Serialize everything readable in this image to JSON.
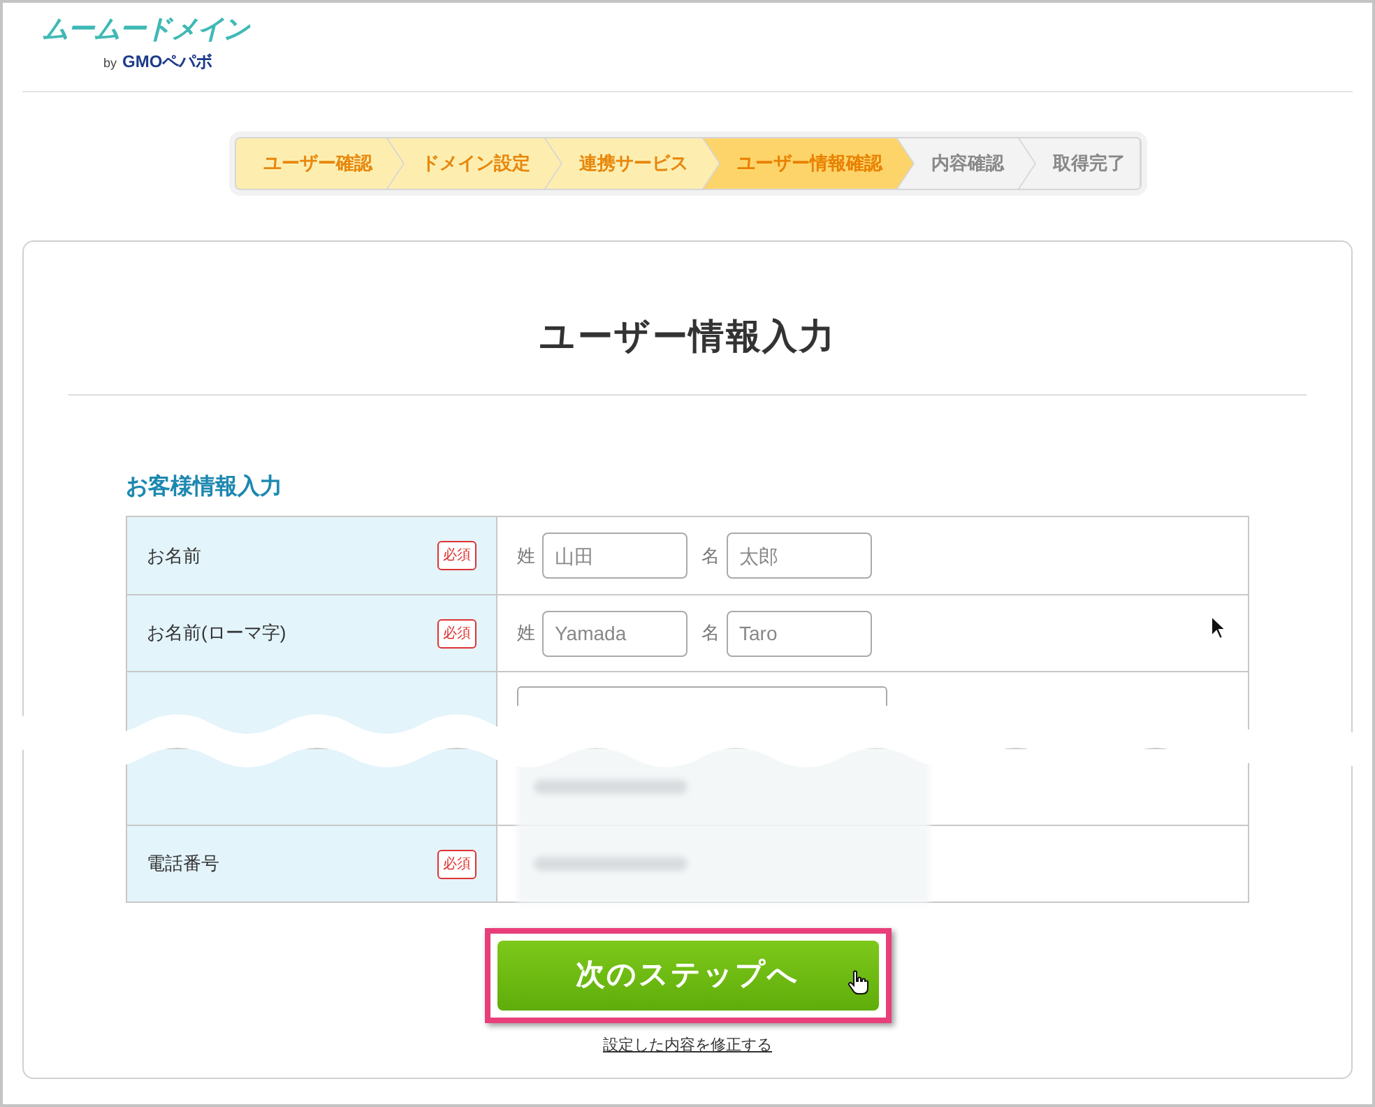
{
  "logo": {
    "name": "ムームードメイン",
    "by": "by",
    "company": "GMOペパボ"
  },
  "steps": [
    {
      "label": "ユーザー確認",
      "completed": true,
      "selected": false
    },
    {
      "label": "ドメイン設定",
      "completed": true,
      "selected": false
    },
    {
      "label": "連携サービス",
      "completed": true,
      "selected": false
    },
    {
      "label": "ユーザー情報確認",
      "completed": false,
      "selected": true
    },
    {
      "label": "内容確認",
      "completed": false,
      "selected": false
    },
    {
      "label": "取得完了",
      "completed": false,
      "selected": false
    }
  ],
  "title": "ユーザー情報入力",
  "section_title": "お客様情報入力",
  "rows": [
    {
      "kind": "name",
      "label": "お名前",
      "required": true,
      "badge": "必須",
      "fields": [
        {
          "prefix": "姓",
          "placeholder": "山田"
        },
        {
          "prefix": "名",
          "placeholder": "太郎"
        }
      ]
    },
    {
      "kind": "name",
      "label": "お名前(ローマ字)",
      "required": true,
      "badge": "必須",
      "fields": [
        {
          "prefix": "姓",
          "placeholder": "Yamada"
        },
        {
          "prefix": "名",
          "placeholder": "Taro"
        }
      ]
    },
    {
      "kind": "select"
    },
    {
      "kind": "blurred"
    },
    {
      "kind": "blurred",
      "label": "電話番号",
      "required": true,
      "badge": "必須"
    }
  ],
  "next_button": "次のステップへ",
  "edit_link": "設定した内容を修正する"
}
